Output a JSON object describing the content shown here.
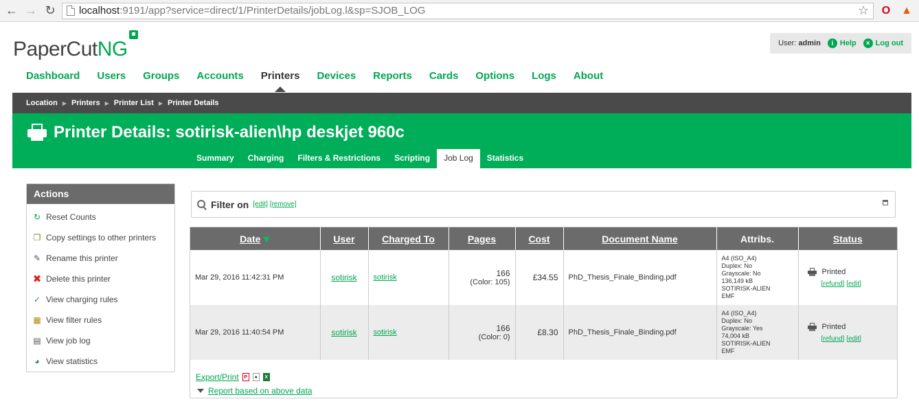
{
  "browser": {
    "url_host": "localhost",
    "url_rest": ":9191/app?service=direct/1/PrinterDetails/jobLog.l&sp=SJOB_LOG"
  },
  "header": {
    "logo_main": "PaperCut",
    "logo_accent": "NG",
    "user_label": "User:",
    "user_name": "admin",
    "help_label": "Help",
    "logout_label": "Log out"
  },
  "nav": {
    "items": [
      "Dashboard",
      "Users",
      "Groups",
      "Accounts",
      "Printers",
      "Devices",
      "Reports",
      "Cards",
      "Options",
      "Logs",
      "About"
    ],
    "active": "Printers"
  },
  "breadcrumb": [
    "Location",
    "Printers",
    "Printer List",
    "Printer Details"
  ],
  "banner": {
    "title": "Printer Details: sotirisk-alien\\hp deskjet 960c",
    "tabs": [
      "Summary",
      "Charging",
      "Filters & Restrictions",
      "Scripting",
      "Job Log",
      "Statistics"
    ],
    "active_tab": "Job Log"
  },
  "actions": {
    "title": "Actions",
    "items": [
      {
        "label": "Reset Counts",
        "icon": "reset-icon"
      },
      {
        "label": "Copy settings to other printers",
        "icon": "copy-icon"
      },
      {
        "label": "Rename this printer",
        "icon": "pencil-icon"
      },
      {
        "label": "Delete this printer",
        "icon": "delete-icon"
      },
      {
        "label": "View charging rules",
        "icon": "charging-rules-icon"
      },
      {
        "label": "View filter rules",
        "icon": "filter-rules-icon"
      },
      {
        "label": "View job log",
        "icon": "job-log-icon"
      },
      {
        "label": "View statistics",
        "icon": "pie-chart-icon"
      }
    ]
  },
  "filter": {
    "label": "Filter on",
    "edit": "[edit]",
    "remove": "[remove]"
  },
  "table": {
    "headers": {
      "date": "Date",
      "user": "User",
      "charged_to": "Charged To",
      "pages": "Pages",
      "cost": "Cost",
      "document": "Document Name",
      "attribs": "Attribs.",
      "status": "Status"
    },
    "rows": [
      {
        "date": "Mar 29, 2016 11:42:31 PM",
        "user": "sotirisk",
        "charged_to": "sotirisk",
        "pages": "166",
        "pages_color": "(Color: 105)",
        "cost": "£34.55",
        "document": "PhD_Thesis_Finale_Binding.pdf",
        "attribs": [
          "A4 (ISO_A4)",
          "Duplex: No",
          "Grayscale: No",
          "136,149 kB",
          "SOTIRISK-ALIEN",
          "EMF"
        ],
        "status": "Printed",
        "refund": "[refund]",
        "edit": "[edit]"
      },
      {
        "date": "Mar 29, 2016 11:40:54 PM",
        "user": "sotirisk",
        "charged_to": "sotirisk",
        "pages": "166",
        "pages_color": "(Color: 0)",
        "cost": "£8.30",
        "document": "PhD_Thesis_Finale_Binding.pdf",
        "attribs": [
          "A4 (ISO_A4)",
          "Duplex: No",
          "Grayscale: Yes",
          "74,004 kB",
          "SOTIRISK-ALIEN",
          "EMF"
        ],
        "status": "Printed",
        "refund": "[refund]",
        "edit": "[edit]"
      }
    ],
    "export_label": "Export/Print",
    "report_label": "Report based on above data"
  },
  "colors": {
    "brand_green": "#00a650",
    "banner_green": "#00ad58",
    "dark_gray": "#4a4a4a",
    "header_gray": "#6b6b6b"
  }
}
